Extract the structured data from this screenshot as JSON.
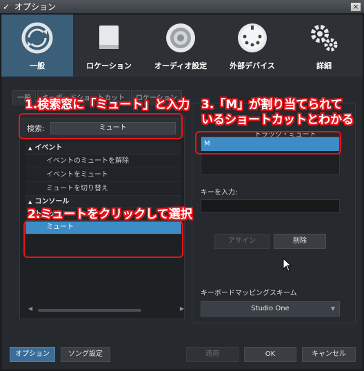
{
  "window": {
    "title": "オプション",
    "close": "×"
  },
  "categories": [
    {
      "label": "一般",
      "icon": "sync-icon",
      "active": true
    },
    {
      "label": "ロケーション",
      "icon": "drive-icon",
      "active": false
    },
    {
      "label": "オーディオ設定",
      "icon": "speaker-icon",
      "active": false
    },
    {
      "label": "外部デバイス",
      "icon": "midi-icon",
      "active": false
    },
    {
      "label": "詳細",
      "icon": "gears-icon",
      "active": false
    }
  ],
  "tabs": [
    "一般",
    "キーボードショートカット",
    "ロケーション"
  ],
  "search": {
    "label": "検索:",
    "value": "ミュート"
  },
  "tree": {
    "groups": [
      {
        "name": "イベント",
        "items": [
          "イベントのミュートを解除",
          "イベントをミュート",
          "ミュートを切り替え"
        ]
      },
      {
        "name": "コンソール",
        "items": []
      },
      {
        "name": "トラック",
        "items": [
          "ミュート"
        ]
      }
    ]
  },
  "right_panel": {
    "header": "トラック・ミュート",
    "shortcut_value": "M",
    "key_input_label": "キーを入力:",
    "assign_button": "アサイン",
    "delete_button": "削除",
    "scheme_label": "キーボードマッピングスキーム",
    "scheme_value": "Studio One"
  },
  "footer": {
    "options_button": "オプション",
    "song_settings_button": "ソング設定",
    "apply_button": "適用",
    "ok_button": "OK",
    "cancel_button": "キャンセル"
  },
  "annotations": {
    "step1": "1.検索窓に「ミュート」と入力",
    "step2": "2.ミュートをクリックして選択",
    "step3_line1": "3.「M」が割り当てられて",
    "step3_line2": "いるショートカットとわかる"
  },
  "colors": {
    "accent": "#3d8cc6",
    "annotation": "#e8141b",
    "active_category": "#3b5f78"
  }
}
